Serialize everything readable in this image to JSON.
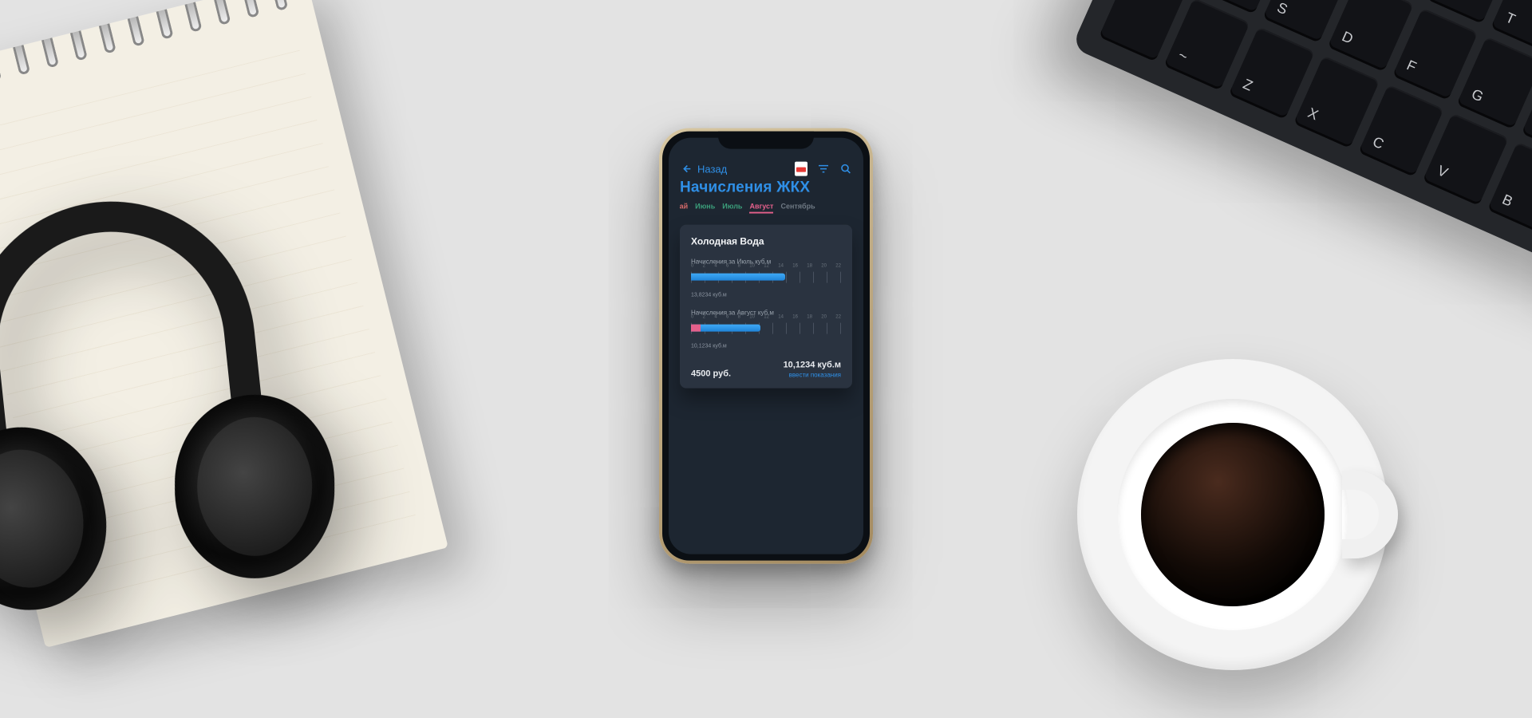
{
  "header": {
    "back_label": "Назад",
    "title": "Начисления ЖКХ"
  },
  "icons": {
    "pdf": "pdf-icon",
    "filter": "filter-icon",
    "search": "search-icon",
    "back": "arrow-left-icon"
  },
  "months": {
    "items": [
      {
        "label": "Май",
        "state": "may"
      },
      {
        "label": "Июнь",
        "state": "past"
      },
      {
        "label": "Июль",
        "state": "past"
      },
      {
        "label": "Август",
        "state": "active"
      },
      {
        "label": "Сентябрь",
        "state": "future"
      }
    ]
  },
  "card": {
    "title": "Холодная Вода",
    "scale_ticks": [
      "0",
      "2",
      "4",
      "6",
      "8",
      "10",
      "12",
      "14",
      "16",
      "18",
      "20",
      "22"
    ],
    "meters": [
      {
        "label": "Начисления за Июль куб.м",
        "value_text": "13,8234 куб.м",
        "value_num": 13.8234,
        "max": 22
      },
      {
        "label": "Начисления за Август куб.м",
        "value_text": "10,1234 куб.м",
        "value_num": 10.1234,
        "max": 22
      }
    ],
    "price": "4500 руб.",
    "volume": "10,1234 куб.м",
    "enter_link": "ввести показания"
  },
  "chart_data": {
    "type": "bar",
    "title": "Холодная Вода",
    "xlabel": "куб.м",
    "ylabel": "",
    "xlim": [
      0,
      22
    ],
    "categories": [
      "Июль",
      "Август"
    ],
    "values": [
      13.8234,
      10.1234
    ]
  },
  "colors": {
    "accent": "#2f8fe6",
    "pink": "#e4608b",
    "card": "#2a3340",
    "app_bg": "#1d2631"
  }
}
